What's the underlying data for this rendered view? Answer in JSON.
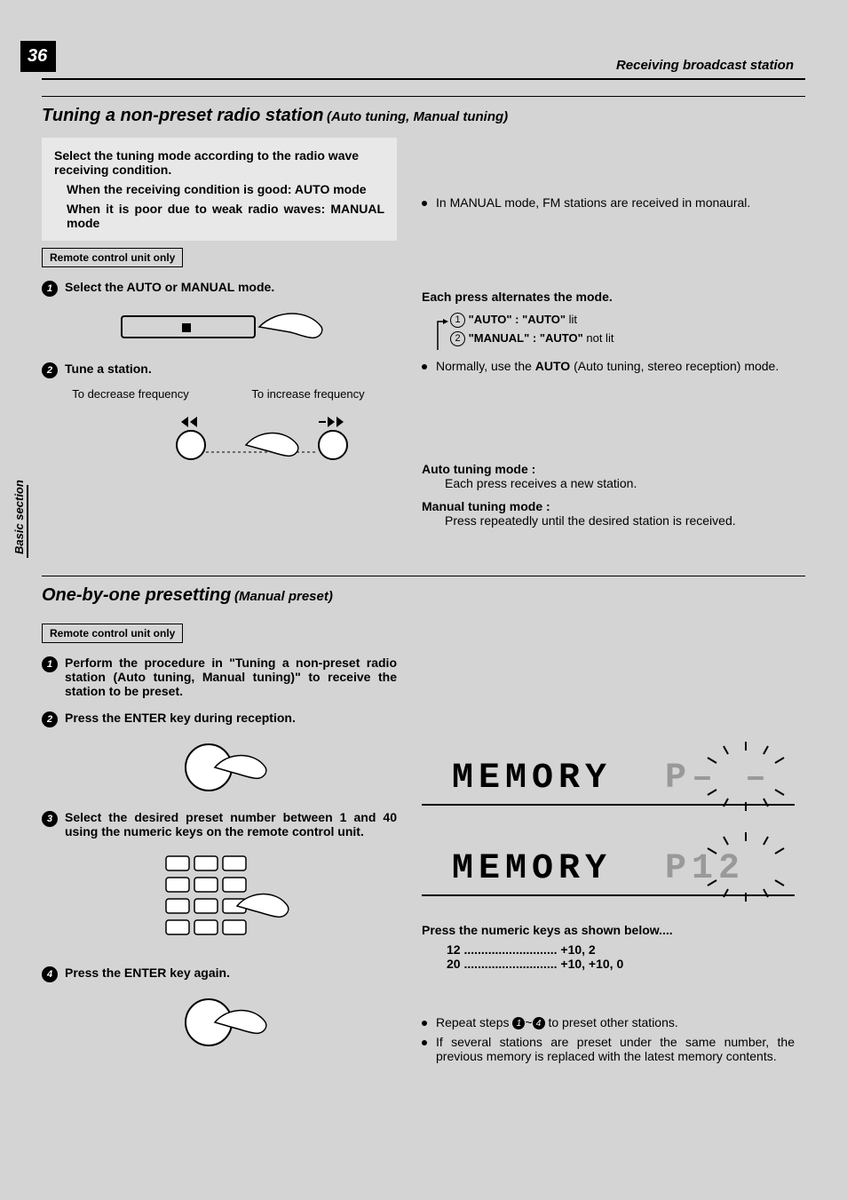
{
  "page": {
    "number": "36"
  },
  "header": {
    "right": "Receiving broadcast station"
  },
  "sideTab": "Basic section",
  "section1": {
    "title": "Tuning a non-preset radio station",
    "subtitle": "(Auto tuning, Manual tuning)",
    "intro": {
      "lead": "Select the tuning mode according to the radio wave receiving condition.",
      "good": "When the receiving condition is good: AUTO mode",
      "poor": "When it is poor due to weak radio waves: MANUAL mode"
    },
    "remoteLabel": "Remote control unit only",
    "step1": "Select the AUTO or MANUAL mode.",
    "step2": "Tune a station.",
    "tuneLeft": "To decrease frequency",
    "tuneRight": "To increase frequency"
  },
  "right1": {
    "monauralNote": "In MANUAL mode, FM stations are received in monaural.",
    "alternateHeading": "Each press alternates the mode.",
    "mode1Label": "\"AUTO\" : \"AUTO\"",
    "mode1State": "lit",
    "mode2Label": "\"MANUAL\" : \"AUTO\"",
    "mode2State": "not lit",
    "normallyPrefix": "Normally, use the ",
    "normallyBold": "AUTO",
    "normallySuffix": " (Auto tuning, stereo reception) mode.",
    "autoHeading": "Auto tuning mode :",
    "autoBody": "Each press receives a new station.",
    "manualHeading": "Manual tuning mode :",
    "manualBody": "Press repeatedly until the desired station is received."
  },
  "section2": {
    "title": "One-by-one presetting",
    "subtitle": "(Manual preset)",
    "remoteLabel": "Remote control unit only",
    "step1": "Perform the procedure in \"Tuning a non-preset radio station  (Auto tuning, Manual tuning)\" to receive the station to be preset.",
    "step2": "Press the ENTER key during reception.",
    "step3": "Select the desired preset number between 1 and 40 using the numeric keys on the remote control unit.",
    "step4": "Press the ENTER key again."
  },
  "right2": {
    "display1": "MEMORY",
    "display1right": "P– –",
    "display2": "MEMORY",
    "display2right": "P12",
    "numericHeading": "Press the numeric keys as shown below....",
    "line1left": "12",
    "line1right": "+10, 2",
    "line2left": "20",
    "line2right": "+10, +10, 0",
    "repeatPrefix": "Repeat steps ",
    "repeatMid": "~",
    "repeatSuffix": " to preset other stations.",
    "replaceNote": "If several stations are preset under the same number, the previous memory is replaced with the latest memory contents."
  }
}
